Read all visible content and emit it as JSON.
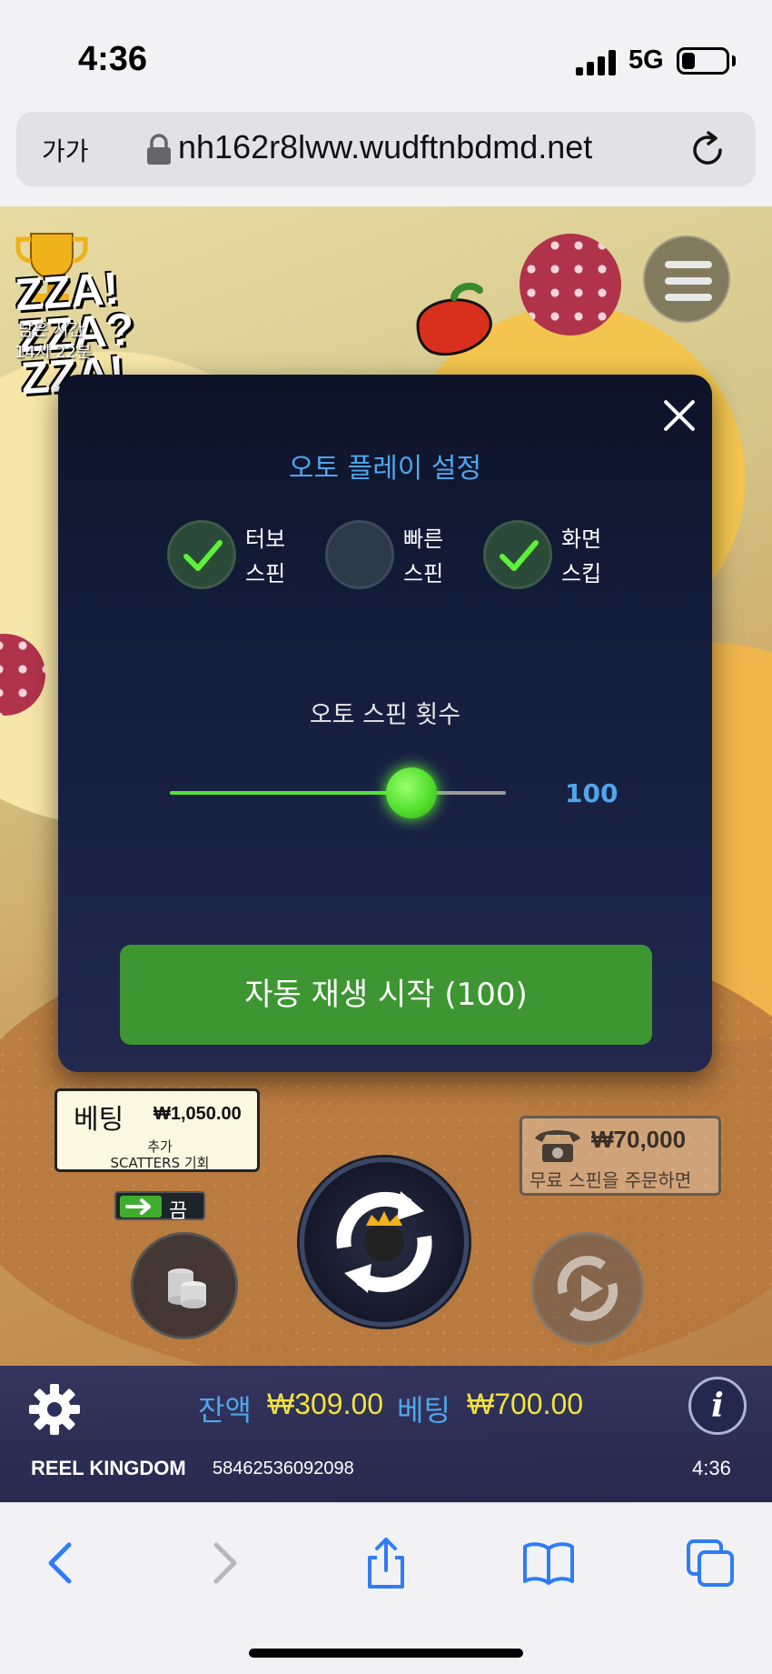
{
  "status_bar": {
    "time": "4:36",
    "network": "5G"
  },
  "browser": {
    "text_size_label": "가가",
    "url": "nh162r8lww.wudftnbdmd.net"
  },
  "game": {
    "logo_text": [
      "ZZA!",
      "ZZA?",
      "ZZA!"
    ],
    "remaining_time_label": "남은 시간",
    "remaining_time_value": "14시 22분",
    "modal": {
      "title": "오토 플레이 설정",
      "options": [
        {
          "label_line1": "터보",
          "label_line2": "스핀",
          "checked": true
        },
        {
          "label_line1": "빠른",
          "label_line2": "스핀",
          "checked": false
        },
        {
          "label_line1": "화면",
          "label_line2": "스킵",
          "checked": true
        }
      ],
      "spin_count_title": "오토 스핀 횟수",
      "spin_count_value": "100",
      "slider_fraction": 0.72,
      "start_button": "자동 재생 시작 (100)"
    },
    "bet_sign": {
      "label": "베팅",
      "value": "₩1,050.00",
      "extra_line1": "추가",
      "extra_line2": "SCATTERS 기회",
      "toggle_state": "끔"
    },
    "buy_feature": {
      "value": "₩70,000",
      "label": "무료 스핀을 주문하면"
    },
    "hud": {
      "balance_label": "잔액",
      "balance_value": "₩309.00",
      "bet_label": "베팅",
      "bet_value": "₩700.00",
      "brand": "REEL KINGDOM",
      "round_id": "58462536092098",
      "clock": "4:36"
    },
    "colors": {
      "accent_blue": "#4fa6ec",
      "accent_green": "#3d9631",
      "balance_yellow": "#f5e23c"
    }
  },
  "toolbar": {
    "icons": [
      "back-icon",
      "forward-icon",
      "share-icon",
      "bookmarks-icon",
      "tabs-icon"
    ]
  }
}
